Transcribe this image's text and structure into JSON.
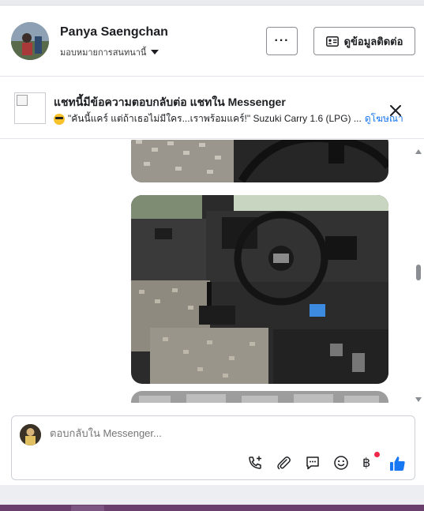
{
  "header": {
    "name": "Panya Saengchan",
    "subtitle": "มอบหมายการสนทนานี้",
    "more_label": "···",
    "contact_label": "ดูข้อมูลติดต่อ"
  },
  "banner": {
    "title": "แชทนี้มีข้อความตอบกลับต่อ แชทใน Messenger",
    "message": "\"คันนี้แคร์ แต่ถ้าเธอไม่มีใคร...เราพร้อมแคร์!\" Suzuki Carry 1.6 (LPG) ...",
    "ad_label": "ดูโฆษณา"
  },
  "composer": {
    "placeholder": "ตอบกลับใน Messenger..."
  },
  "icons": {
    "call": "phone-plus-icon",
    "attach": "paperclip-icon",
    "chat": "chat-bubble-icon",
    "emoji": "smile-icon",
    "payment": "baht-icon",
    "like": "thumbs-up-icon"
  },
  "colors": {
    "accent": "#1877f2",
    "like": "#1877f2",
    "notification_dot": "#f02849"
  }
}
